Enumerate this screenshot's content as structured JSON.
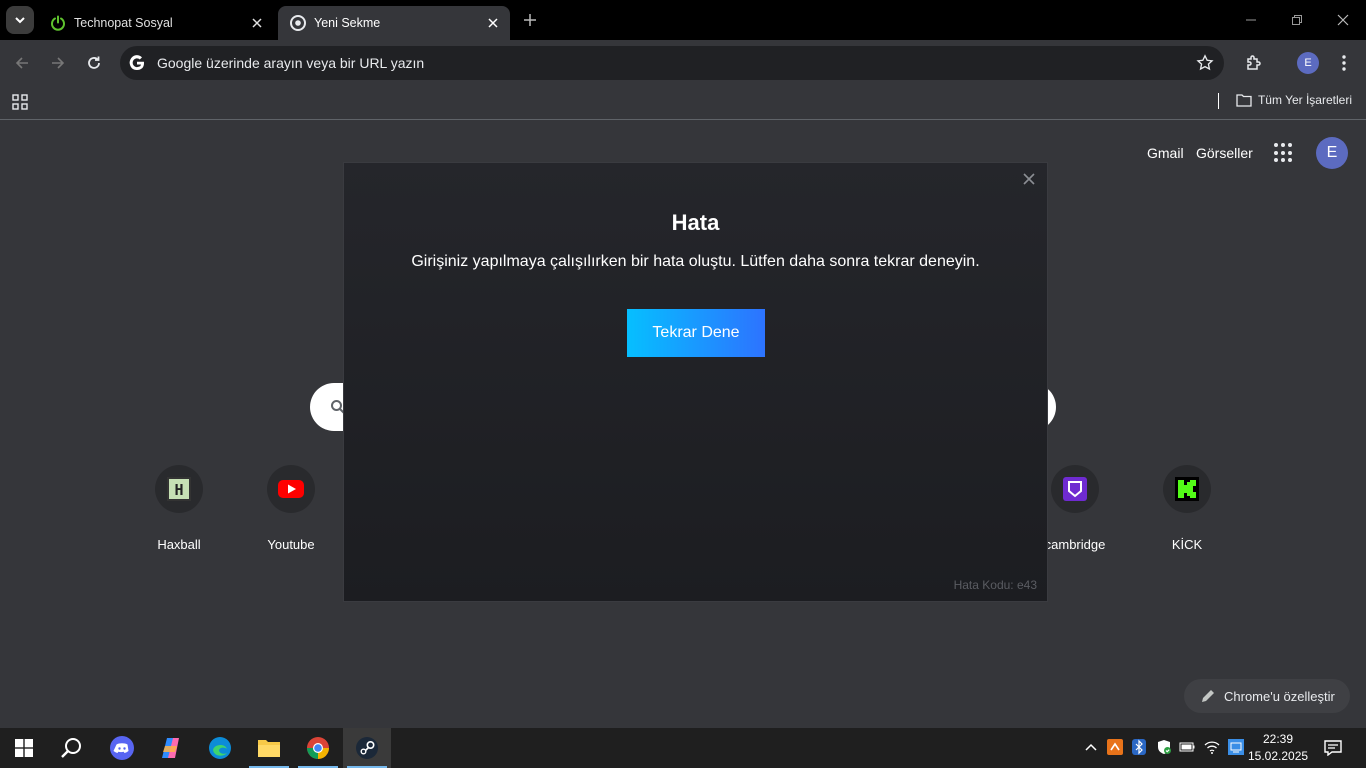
{
  "browser": {
    "tabs": [
      {
        "title": "Technopat Sosyal",
        "active": false
      },
      {
        "title": "Yeni Sekme",
        "active": true
      }
    ],
    "omnibox_placeholder": "Google üzerinde arayın veya bir URL yazın",
    "profile_initial": "E",
    "bookmarks": {
      "all_bookmarks_label": "Tüm Yer İşaretleri"
    }
  },
  "ntp": {
    "links": {
      "gmail": "Gmail",
      "images": "Görseller"
    },
    "avatar_initial": "E",
    "shortcuts": [
      {
        "label": "Haxball",
        "icon": "haxball-icon"
      },
      {
        "label": "Youtube",
        "icon": "youtube-icon"
      },
      {
        "label": "cambridge",
        "icon": "cambridge-icon"
      },
      {
        "label": "KİCK",
        "icon": "kick-icon"
      }
    ],
    "customize_label": "Chrome'u özelleştir"
  },
  "modal": {
    "title": "Hata",
    "message": "Girişiniz yapılmaya çalışılırken bir hata oluştu. Lütfen daha sonra tekrar deneyin.",
    "retry_label": "Tekrar Dene",
    "error_code": "Hata Kodu: e43"
  },
  "taskbar": {
    "apps": [
      "start",
      "search",
      "discord",
      "copilot",
      "edge",
      "file-explorer",
      "chrome",
      "steam"
    ],
    "time": "22:39",
    "date": "15.02.2025"
  },
  "colors": {
    "accent_start": "#06bfff",
    "accent_end": "#2d73ff",
    "avatar": "#5c6bc0"
  }
}
